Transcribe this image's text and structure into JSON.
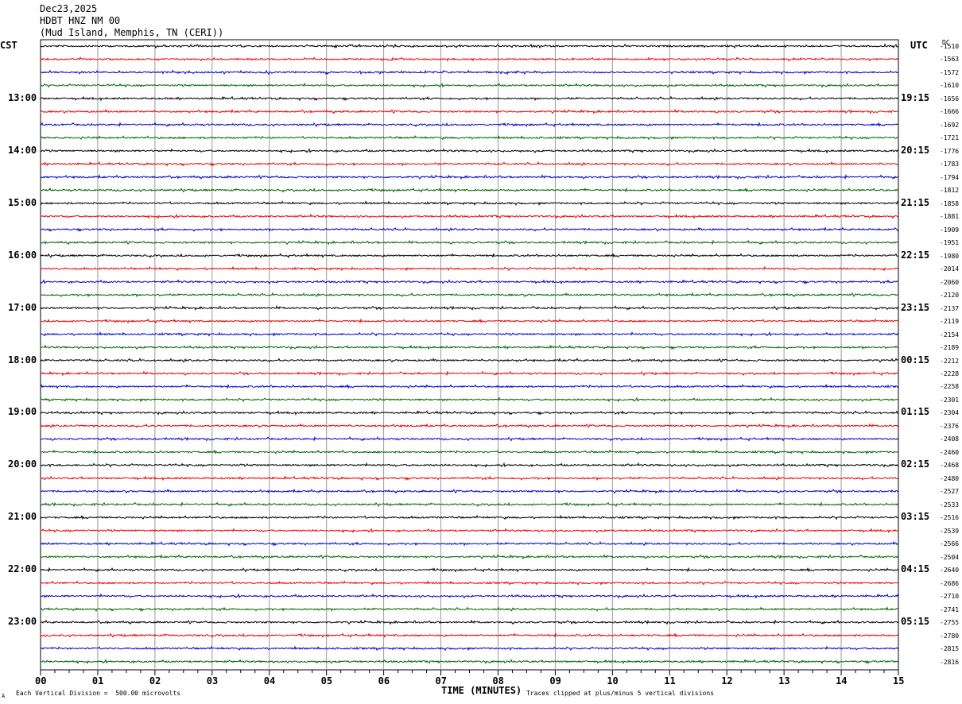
{
  "header": {
    "date": "Dec23,2025",
    "station": "HDBT HNZ NM 00",
    "location": "(Mud Island, Memphis, TN (CERI))"
  },
  "axis": {
    "left_tz": "CST",
    "right_tz": "UTC",
    "dc_label": "DC",
    "x_title": "TIME (MINUTES)",
    "x_ticks": [
      "00",
      "01",
      "02",
      "03",
      "04",
      "05",
      "06",
      "07",
      "08",
      "09",
      "10",
      "11",
      "12",
      "13",
      "14",
      "15"
    ]
  },
  "footer": {
    "corner_mark": "A",
    "scale_note": "Each Vertical Division =  500.00 microvolts",
    "clip_note": "Traces clipped at plus/minus 5 vertical divisions"
  },
  "colors": {
    "trace_cycle": [
      "#000000",
      "#ee0000",
      "#0000cc",
      "#006600"
    ],
    "grid": "#999999"
  },
  "chart_data": {
    "type": "line",
    "title": "",
    "minutes_per_row": 15,
    "xlim": [
      0,
      15
    ],
    "left_hour_labels": [
      "13:00",
      "14:00",
      "15:00",
      "16:00",
      "17:00",
      "18:00",
      "19:00",
      "20:00",
      "21:00",
      "22:00",
      "23:00"
    ],
    "right_hour_labels": [
      "19:15",
      "20:15",
      "21:15",
      "22:15",
      "23:15",
      "00:15",
      "01:15",
      "02:15",
      "03:15",
      "04:15",
      "05:15"
    ],
    "dc_offsets": [
      -1510,
      -1563,
      -1572,
      -1610,
      -1656,
      -1666,
      -1692,
      -1721,
      -1776,
      -1783,
      -1794,
      -1812,
      -1858,
      -1881,
      -1909,
      -1951,
      -1980,
      -2014,
      -2060,
      -2120,
      -2137,
      -2119,
      -2154,
      -2189,
      -2212,
      -2228,
      -2258,
      -2301,
      -2304,
      -2376,
      -2408,
      -2460,
      -2468,
      -2480,
      -2527,
      -2533,
      -2516,
      -2539,
      -2566,
      -2504,
      -2640,
      -2686,
      -2710,
      -2741,
      -2755,
      -2780,
      -2815,
      -2816
    ]
  }
}
